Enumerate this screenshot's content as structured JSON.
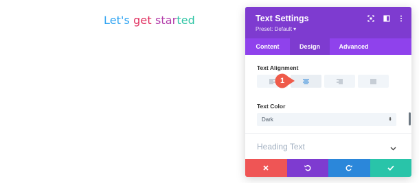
{
  "canvas": {
    "headline": {
      "part1": "Let's",
      "part2": "get",
      "part3a": "star",
      "part3b": "ted"
    }
  },
  "panel": {
    "title": "Text Settings",
    "preset": "Preset: Default ▾",
    "icons": [
      "expand-icon",
      "sidebar-icon",
      "more-icon"
    ],
    "tabs": [
      {
        "label": "Content"
      },
      {
        "label": "Design"
      },
      {
        "label": "Advanced"
      }
    ],
    "active_tab": "Design",
    "text_alignment": {
      "label": "Text Alignment",
      "options": [
        "left",
        "center",
        "right",
        "justify"
      ],
      "selected": "center"
    },
    "text_color": {
      "label": "Text Color",
      "value": "Dark"
    },
    "section": {
      "title": "Heading Text"
    },
    "footer": {
      "buttons": [
        "cancel-icon",
        "undo-icon",
        "redo-icon",
        "save-icon"
      ]
    }
  },
  "callout": {
    "number": "1"
  },
  "colors": {
    "header": "#7e3bd0",
    "tabs": "#8f42ec",
    "cancel": "#ef5555",
    "undo": "#7e3bd0",
    "redo": "#2b87da",
    "save": "#29c4a9",
    "marker": "#ef5b4a"
  }
}
